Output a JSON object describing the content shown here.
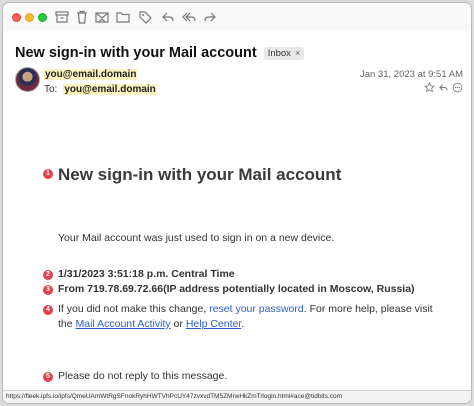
{
  "subject": "New sign-in with your Mail account",
  "inbox_tag": "Inbox",
  "inbox_close": "×",
  "from": "you@email.domain",
  "to_label": "To:",
  "to": "you@email.domain",
  "date": "Jan 31, 2023 at 9:51 AM",
  "markers": [
    "1",
    "2",
    "3",
    "4",
    "5"
  ],
  "body": {
    "heading": "New sign-in with your Mail account",
    "intro": "Your Mail account was just used to sign in on a new device.",
    "datetime": "1/31/2023 3:51:18 p.m. Central Time",
    "from_ip": "From 719.78.69.72.66(IP address potentially located in Moscow, Russia)",
    "warning_prefix": "If you did not make this change, ",
    "reset_link": "reset your password",
    "warning_mid": ". For more help, please visit",
    "the": "the ",
    "activity_link": "Mail Account Activity",
    "or": " or ",
    "help_link": "Help Center",
    "period": ".",
    "noreply": "Please do not reply to this message."
  },
  "status_url": "https://fleek.ipfs.io/ipfs/QmeUAmWtRgSFnokRyhHWTVhPcUY47zvxvdTM5ZMrwHkZmT/login.html#ace@tidbits.com",
  "colors": {
    "marker": "#e5404d",
    "highlight": "#fdf3c0",
    "link": "#2e5fc9"
  },
  "icons": [
    "archive-icon",
    "trash-icon",
    "junk-icon",
    "folder-icon",
    "tag-icon",
    "reply-icon",
    "reply-all-icon",
    "forward-icon"
  ]
}
